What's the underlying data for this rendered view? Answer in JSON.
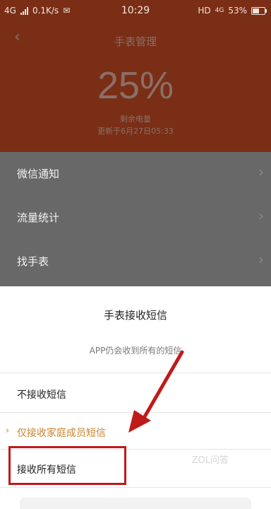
{
  "status_bar": {
    "network": "4G",
    "speed": "0.1K/s",
    "time": "10:29",
    "hd": "HD",
    "signal2": "4G",
    "battery": "53%"
  },
  "header": {
    "title": "手表管理",
    "battery_percent": "25%",
    "battery_label": "剩余电量",
    "updated": "更新于6月27日05:33"
  },
  "menu": {
    "items": [
      {
        "label": "微信通知"
      },
      {
        "label": "流量统计"
      },
      {
        "label": "找手表"
      }
    ]
  },
  "sheet": {
    "title": "手表接收短信",
    "description": "APP仍会收到所有的短信",
    "options": [
      {
        "label": "不接收短信"
      },
      {
        "label": "仅接收家庭成员短信",
        "selected_mark": "›"
      },
      {
        "label": "接收所有短信"
      }
    ],
    "watermark": "ZOL问答"
  },
  "colors": {
    "header_bg": "#7a2e16",
    "selected": "#c8852f",
    "annotation": "#c01a1a"
  }
}
